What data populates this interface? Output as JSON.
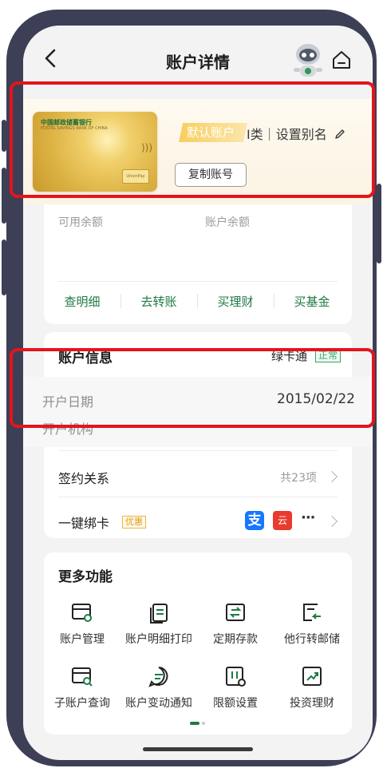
{
  "header": {
    "title": "账户详情"
  },
  "card": {
    "bank_name": "中国邮政储蓄银行",
    "bank_name_en": "POSTAL SAVINGS BANK OF CHINA",
    "default_tag": "默认账户",
    "card_type": "I类｜设置别名",
    "copy_label": "复制账号"
  },
  "balance": {
    "available_label": "可用余额",
    "account_label": "账户余额",
    "actions": [
      "查明细",
      "去转账",
      "买理财",
      "买基金"
    ]
  },
  "info": {
    "title": "账户信息",
    "product": "绿卡通",
    "status": "正常",
    "open_date_label": "开户日期",
    "open_date": "2015/02/22",
    "branch_label": "开户机构"
  },
  "sign": {
    "title": "签约关系",
    "count": "共23项"
  },
  "bind": {
    "title": "一键绑卡",
    "promo": "优惠",
    "more": "···"
  },
  "functions": {
    "title": "更多功能",
    "items": [
      {
        "label": "账户管理",
        "icon": "account-manage-icon"
      },
      {
        "label": "账户明细打印",
        "icon": "print-detail-icon"
      },
      {
        "label": "定期存款",
        "icon": "deposit-icon"
      },
      {
        "label": "他行转邮储",
        "icon": "transfer-in-icon"
      },
      {
        "label": "子账户查询",
        "icon": "sub-account-search-icon"
      },
      {
        "label": "账户变动通知",
        "icon": "notify-icon"
      },
      {
        "label": "限额设置",
        "icon": "limit-setting-icon"
      },
      {
        "label": "投资理财",
        "icon": "invest-icon"
      }
    ]
  },
  "colors": {
    "accent": "#1f7a45",
    "highlight": "#e4141c",
    "gold": "#f8ce5e"
  }
}
